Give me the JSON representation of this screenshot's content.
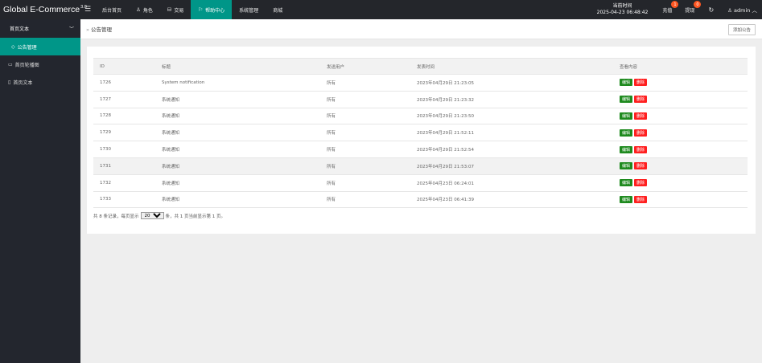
{
  "brand": {
    "name": "Global E-Commerce",
    "version": "3.0"
  },
  "nav": [
    {
      "label": "后台首页",
      "icon": ""
    },
    {
      "label": "角色",
      "icon": "person-icon"
    },
    {
      "label": "交易",
      "icon": "stack-icon"
    },
    {
      "label": "帮助中心",
      "icon": "flag-icon",
      "active": true
    },
    {
      "label": "系统管理",
      "icon": ""
    },
    {
      "label": "商城",
      "icon": ""
    }
  ],
  "topright": {
    "time_label": "当前时间",
    "time_value": "2025-04-23 06:48:42",
    "recharge_label": "充值",
    "recharge_badge": "1",
    "withdraw_label": "提现",
    "withdraw_badge": "0",
    "admin_label": "admin"
  },
  "sidebar": {
    "group_label": "首页文本",
    "items": [
      {
        "label": "公告管理",
        "active": true
      },
      {
        "label": "首页轮播图"
      },
      {
        "label": "首页文本"
      }
    ]
  },
  "breadcrumb": {
    "label": "公告管理"
  },
  "toolbar": {
    "add_label": "添加公告"
  },
  "table": {
    "headers": [
      "ID",
      "标题",
      "发送用户",
      "发表时间",
      "查看内容"
    ],
    "edit_label": "编辑",
    "delete_label": "删除",
    "rows": [
      {
        "id": "1726",
        "title": "System notification",
        "user": "所有",
        "time": "2023年04月29日 21:23:05"
      },
      {
        "id": "1727",
        "title": "系统通知",
        "user": "所有",
        "time": "2023年04月29日 21:23:32"
      },
      {
        "id": "1728",
        "title": "系统通知",
        "user": "所有",
        "time": "2023年04月29日 21:23:50"
      },
      {
        "id": "1729",
        "title": "系统通知",
        "user": "所有",
        "time": "2023年04月29日 21:52:11"
      },
      {
        "id": "1730",
        "title": "系统通知",
        "user": "所有",
        "time": "2023年04月29日 21:52:54"
      },
      {
        "id": "1731",
        "title": "系统通知",
        "user": "所有",
        "time": "2023年04月29日 21:53:07",
        "highlight": true
      },
      {
        "id": "1732",
        "title": "系统通知",
        "user": "所有",
        "time": "2025年04月23日 06:24:01"
      },
      {
        "id": "1733",
        "title": "系统通知",
        "user": "所有",
        "time": "2025年04月23日 06:41:39"
      }
    ]
  },
  "pager": {
    "prefix": "共 8 条记录，每页显示",
    "page_size": "20",
    "suffix": "条，共 1 页当前显示第 1 页。"
  },
  "colors": {
    "accent": "#009688",
    "topbar": "#24262b",
    "sidebar": "#23262e",
    "edit": "#1e8a1e",
    "delete": "#ff2020",
    "badge": "#ff5722"
  }
}
